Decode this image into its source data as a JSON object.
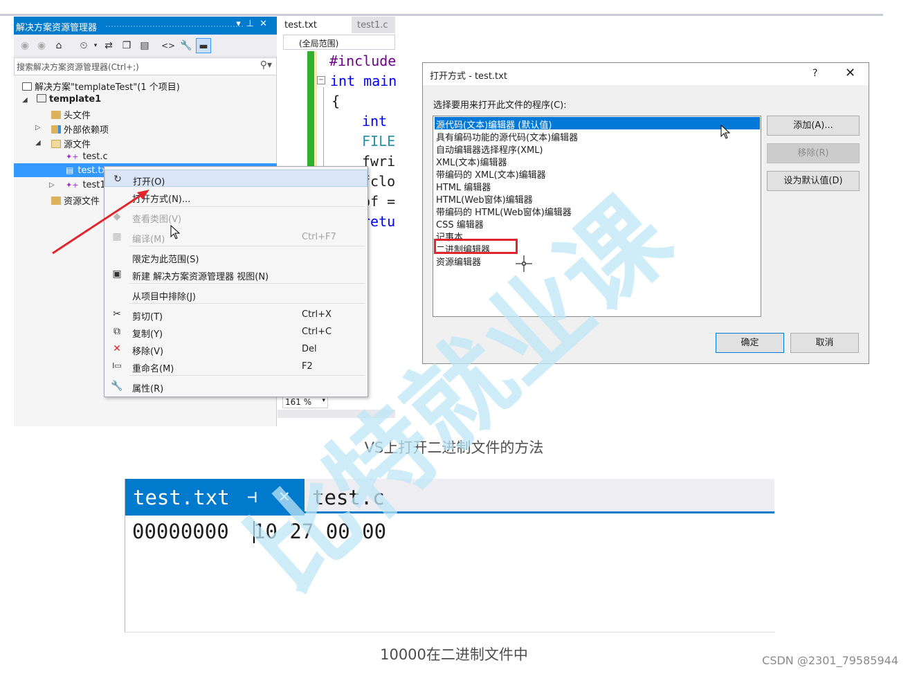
{
  "solution_explorer": {
    "title": "解决方案资源管理器",
    "search_placeholder": "搜索解决方案资源管理器(Ctrl+;)",
    "solution_label": "解决方案\"templateTest\"(1 个项目)",
    "project": "template1",
    "items": [
      "头文件",
      "外部依赖项",
      "源文件",
      "test.c",
      "test.txt",
      "test1",
      "资源文件"
    ]
  },
  "editor": {
    "tabs": [
      "test.txt",
      "test1.c"
    ],
    "scope": "(全局范围)",
    "lines": [
      "#include",
      "int main",
      "{",
      "int",
      "FILE",
      "fwri",
      "fclo",
      "pf =",
      "retu"
    ],
    "zoom": "161 %"
  },
  "context_menu": {
    "items": [
      {
        "label": "打开(O)",
        "shortcut": ""
      },
      {
        "label": "打开方式(N)...",
        "shortcut": ""
      },
      {
        "label": "查看类图(V)",
        "shortcut": ""
      },
      {
        "label": "编译(M)",
        "shortcut": "Ctrl+F7"
      },
      {
        "label": "限定为此范围(S)",
        "shortcut": ""
      },
      {
        "label": "新建 解决方案资源管理器 视图(N)",
        "shortcut": ""
      },
      {
        "label": "从项目中排除(J)",
        "shortcut": ""
      },
      {
        "label": "剪切(T)",
        "shortcut": "Ctrl+X"
      },
      {
        "label": "复制(Y)",
        "shortcut": "Ctrl+C"
      },
      {
        "label": "移除(V)",
        "shortcut": "Del"
      },
      {
        "label": "重命名(M)",
        "shortcut": "F2"
      },
      {
        "label": "属性(R)",
        "shortcut": ""
      }
    ]
  },
  "open_with_dialog": {
    "title": "打开方式 - test.txt",
    "help": "?",
    "close": "✕",
    "prompt": "选择要用来打开此文件的程序(C):",
    "programs": [
      "源代码(文本)编辑器 (默认值)",
      "具有编码功能的源代码(文本)编辑器",
      "自动编辑器选择程序(XML)",
      "XML(文本)编辑器",
      "带编码的 XML(文本)编辑器",
      "HTML 编辑器",
      "HTML(Web窗体)编辑器",
      "带编码的 HTML(Web窗体)编辑器",
      "CSS 编辑器",
      "记事本",
      "二进制编辑器",
      "资源编辑器"
    ],
    "buttons": {
      "add": "添加(A)...",
      "remove": "移除(R)",
      "set_default": "设为默认值(D)",
      "ok": "确定",
      "cancel": "取消"
    }
  },
  "captions": {
    "top": "VS上打开二进制文件的方法",
    "bottom": "10000在二进制文件中"
  },
  "binary_editor": {
    "tab_active": "test.txt",
    "tab_pin": "⊣",
    "tab_close": "✕",
    "tab_other": "test.c",
    "address": "00000000",
    "bytes": "10 27 00 00"
  },
  "watermark": "比特就业课",
  "credit": "CSDN @2301_79585944",
  "colors": {
    "vs_blue": "#007acc",
    "selection": "#3399ff",
    "highlight_red": "#e0262c",
    "watermark": "#bfe6f7"
  }
}
